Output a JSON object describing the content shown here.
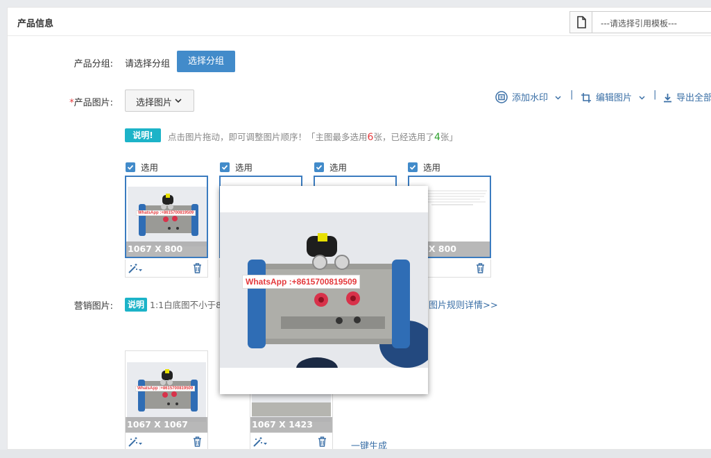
{
  "panel": {
    "title": "产品信息",
    "template_select": {
      "value": "---请选择引用模板---",
      "icon": "file-icon"
    }
  },
  "group": {
    "label": "产品分组",
    "colon": ":",
    "placeholder_text": "请选择分组",
    "button_label": "选择分组"
  },
  "images": {
    "required_mark": "*",
    "label": "产品图片",
    "colon": ":",
    "select_button_label": "选择图片",
    "toolbar": {
      "watermark": "添加水印",
      "edit": "编辑图片",
      "export": "导出全部",
      "separator": "|"
    },
    "hint_badge": "说明!",
    "hint_part1": "点击图片拖动，即可调整图片顺序！「主图最多选用",
    "hint_max": "6",
    "hint_part2": "张，已经选用了",
    "hint_selected": "4",
    "hint_part3": "张」",
    "cards": [
      {
        "check_label": "选用",
        "size": "1067 X 800"
      },
      {
        "check_label": "选用",
        "size": ""
      },
      {
        "check_label": "选用",
        "size": ""
      },
      {
        "check_label": "选用",
        "size": "X 800"
      }
    ]
  },
  "popup": {
    "watermark_text": "WhatsApp :+8615700819509"
  },
  "thumb_watermark": "WhatsApp :+8615700819509",
  "marketing": {
    "label": "营销图片",
    "colon": ":",
    "badge": "说明",
    "hint_text": "1:1白底图不小于8",
    "rules_link": "图片规则详情>>",
    "cards": [
      {
        "size": "1067 X 1067"
      },
      {
        "size": "1067 X 1423"
      }
    ],
    "generate_link": "一键生成"
  },
  "colors": {
    "primary": "#428bca",
    "link": "#3a6fa6",
    "badge": "#1cb3c8",
    "required": "#e4393c",
    "count_selected": "#2ca02c"
  }
}
